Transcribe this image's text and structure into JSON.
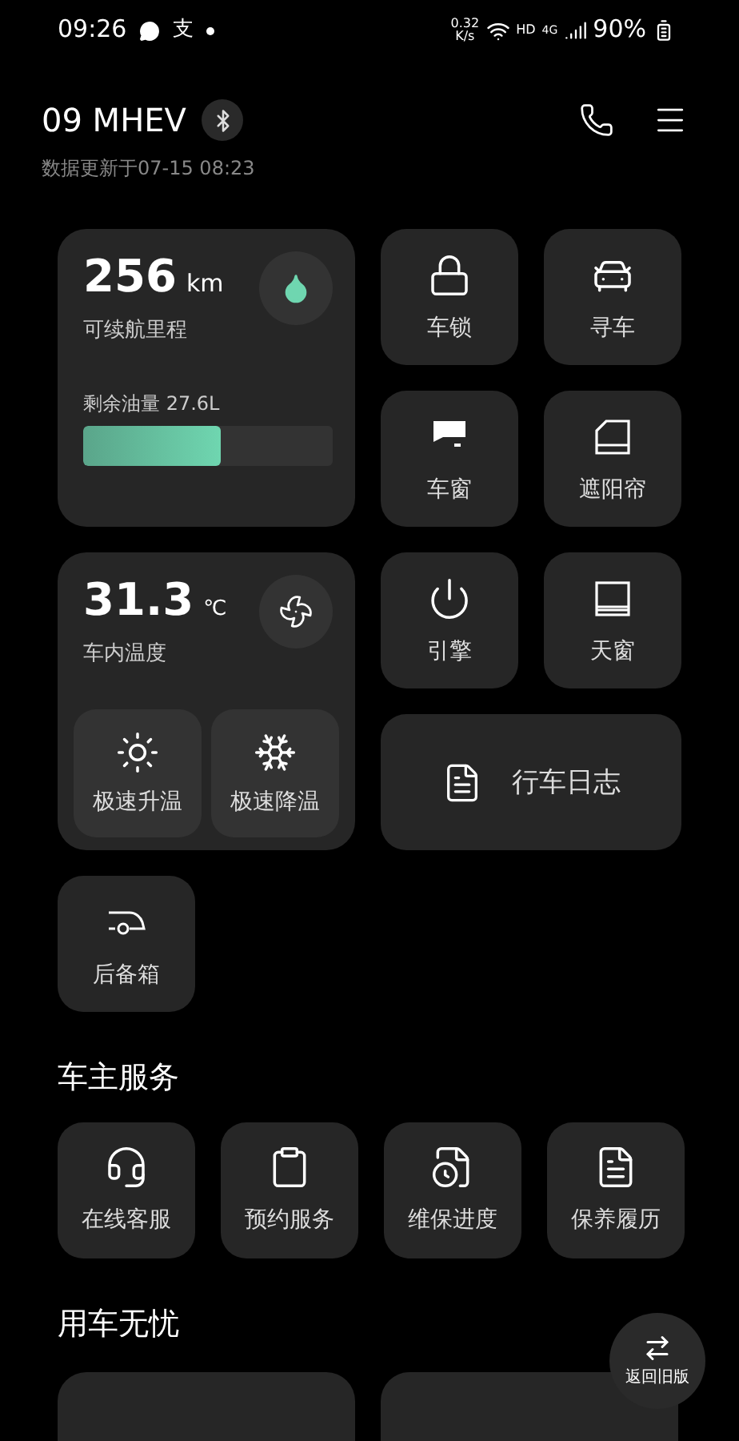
{
  "status_bar": {
    "time": "09:26",
    "app_badge": "支",
    "net_speed_value": "0.32",
    "net_speed_unit": "K/s",
    "hd": "HD",
    "network": "4G",
    "battery": "90%"
  },
  "header": {
    "vehicle": "09 MHEV",
    "updated": "数据更新于07-15 08:23"
  },
  "range_card": {
    "value": "256",
    "unit": "km",
    "label": "可续航里程",
    "fuel_label": "剩余油量 27.6L",
    "level": 0.55
  },
  "climate_card": {
    "value": "31.3",
    "unit": "℃",
    "label": "车内温度",
    "actions": [
      {
        "kind": "heat",
        "label": "极速升温"
      },
      {
        "kind": "cool",
        "label": "极速降温"
      }
    ]
  },
  "controls": [
    {
      "kind": "lock",
      "label": "车锁"
    },
    {
      "kind": "find",
      "label": "寻车"
    },
    {
      "kind": "window",
      "label": "车窗"
    },
    {
      "kind": "shade",
      "label": "遮阳帘"
    },
    {
      "kind": "engine",
      "label": "引擎"
    },
    {
      "kind": "sunroof",
      "label": "天窗"
    }
  ],
  "log": {
    "label": "行车日志"
  },
  "trunk": {
    "label": "后备箱"
  },
  "owner_services": {
    "title": "车主服务",
    "items": [
      {
        "kind": "support",
        "label": "在线客服"
      },
      {
        "kind": "booking",
        "label": "预约服务"
      },
      {
        "kind": "progress",
        "label": "维保进度"
      },
      {
        "kind": "history",
        "label": "保养履历"
      }
    ]
  },
  "worry_free": {
    "title": "用车无忧"
  },
  "floating_button": {
    "label": "返回旧版"
  }
}
